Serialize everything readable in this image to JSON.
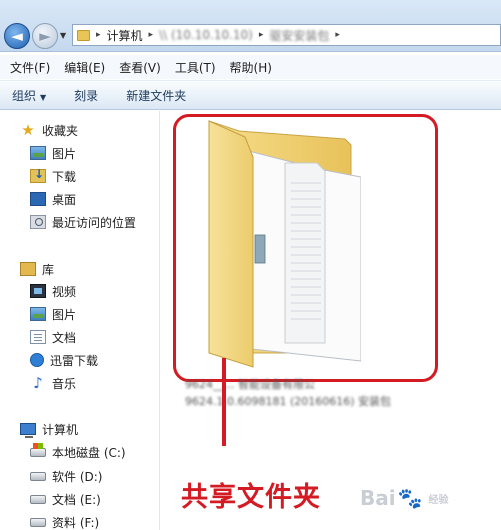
{
  "addressbar": {
    "crumbs": [
      "计算机",
      "\\\\ (10.10.10.10)",
      "驱安安装包"
    ],
    "separator": "▸"
  },
  "menubar": [
    {
      "label": "文件(F)"
    },
    {
      "label": "编辑(E)"
    },
    {
      "label": "查看(V)"
    },
    {
      "label": "工具(T)"
    },
    {
      "label": "帮助(H)"
    }
  ],
  "toolbar": {
    "organize": "组织",
    "burn": "刻录",
    "new_folder": "新建文件夹"
  },
  "sidebar": {
    "favorites": {
      "label": "收藏夹",
      "items": [
        {
          "label": "图片",
          "icon": "picture-icon"
        },
        {
          "label": "下载",
          "icon": "download-icon"
        },
        {
          "label": "桌面",
          "icon": "desktop-icon"
        },
        {
          "label": "最近访问的位置",
          "icon": "recent-places-icon"
        }
      ]
    },
    "libraries": {
      "label": "库",
      "items": [
        {
          "label": "视频",
          "icon": "video-icon"
        },
        {
          "label": "图片",
          "icon": "picture-icon"
        },
        {
          "label": "文档",
          "icon": "document-icon"
        },
        {
          "label": "迅雷下载",
          "icon": "thunder-icon"
        },
        {
          "label": "音乐",
          "icon": "music-icon"
        }
      ]
    },
    "computer": {
      "label": "计算机",
      "items": [
        {
          "label": "本地磁盘 (C:)",
          "icon": "drive-c-icon"
        },
        {
          "label": "软件 (D:)",
          "icon": "drive-icon"
        },
        {
          "label": "文档 (E:)",
          "icon": "drive-icon"
        },
        {
          "label": "资料 (F:)",
          "icon": "drive-icon"
        }
      ]
    }
  },
  "main": {
    "file_line_1": "9624__... 智能设备有限公",
    "file_line_2": "9624.1.0.6098181 (20160616) 安装包",
    "caption": "共享文件夹",
    "caption_color": "#d41a22"
  },
  "watermark": {
    "text": "Bai",
    "paw": "🐾",
    "suffix": "经验"
  }
}
